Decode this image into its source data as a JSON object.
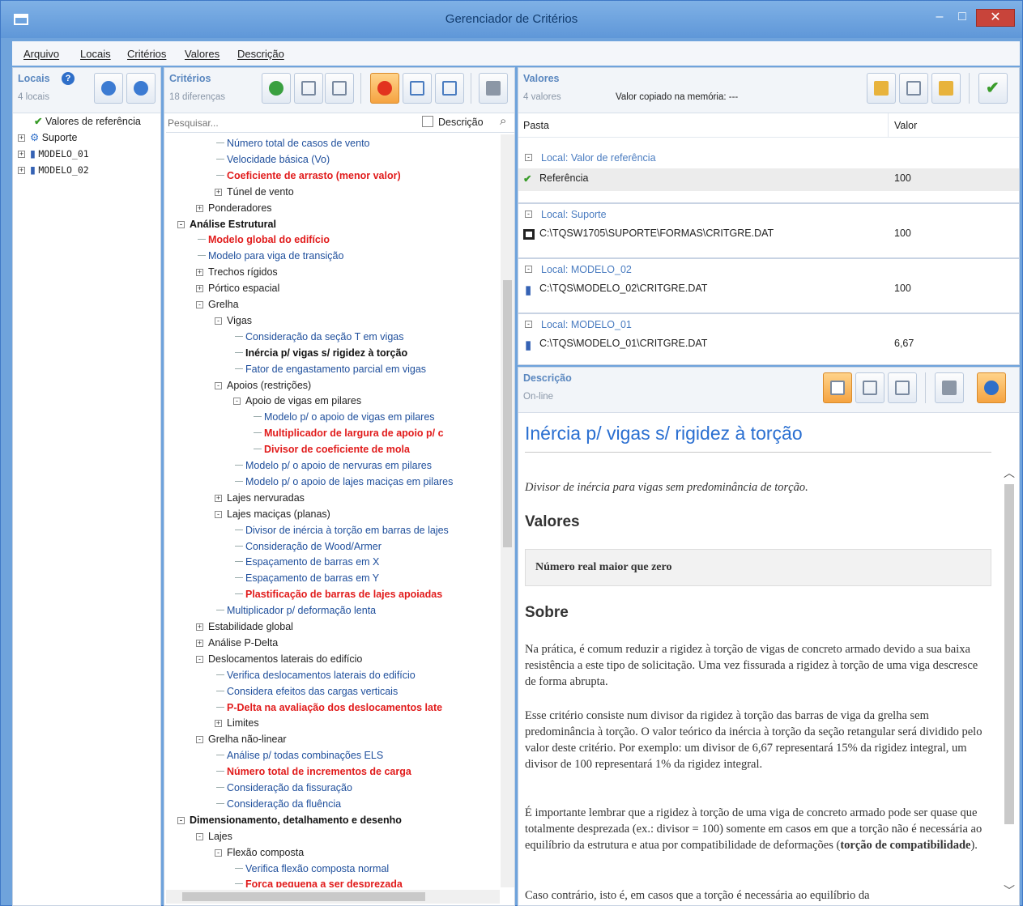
{
  "window": {
    "title": "Gerenciador de Critérios",
    "minimize": "–",
    "maximize": "□",
    "close": "✕"
  },
  "menu": [
    "Arquivo",
    "Locais",
    "Critérios",
    "Valores",
    "Descrição"
  ],
  "locais": {
    "title": "Locais",
    "subtitle": "4 locais",
    "items": [
      "Valores de referência",
      "Suporte",
      "MODELO_01",
      "MODELO_02"
    ]
  },
  "criterios": {
    "title": "Critérios",
    "subtitle": "18 diferenças",
    "search_placeholder": "Pesquisar...",
    "desc_check": "Descrição",
    "tree": [
      {
        "t": "Número total de casos de vento",
        "d": 3,
        "s": "b"
      },
      {
        "t": "Velocidade básica (Vo)",
        "d": 3,
        "s": "b"
      },
      {
        "t": "Coeficiente de arrasto (menor valor)",
        "d": 3,
        "s": "r"
      },
      {
        "t": "Túnel de vento",
        "d": 3,
        "s": "k",
        "e": 1
      },
      {
        "t": "Ponderadores",
        "d": 2,
        "s": "k",
        "e": 1
      },
      {
        "t": "Análise Estrutural",
        "d": 1,
        "s": "kb",
        "e": 2
      },
      {
        "t": "Modelo global do edifício",
        "d": 2,
        "s": "r"
      },
      {
        "t": "Modelo para viga de transição",
        "d": 2,
        "s": "b"
      },
      {
        "t": "Trechos rígidos",
        "d": 2,
        "s": "k",
        "e": 1
      },
      {
        "t": "Pórtico espacial",
        "d": 2,
        "s": "k",
        "e": 1
      },
      {
        "t": "Grelha",
        "d": 2,
        "s": "k",
        "e": 2
      },
      {
        "t": "Vigas",
        "d": 3,
        "s": "k",
        "e": 2
      },
      {
        "t": "Consideração da seção T em vigas",
        "d": 4,
        "s": "b"
      },
      {
        "t": "Inércia p/ vigas s/ rigidez à torção",
        "d": 4,
        "s": "kb"
      },
      {
        "t": "Fator de engastamento parcial em vigas",
        "d": 4,
        "s": "b"
      },
      {
        "t": "Apoios (restrições)",
        "d": 3,
        "s": "k",
        "e": 2
      },
      {
        "t": "Apoio de vigas em pilares",
        "d": 4,
        "s": "k",
        "e": 2
      },
      {
        "t": "Modelo p/ o apoio de vigas em pilares",
        "d": 5,
        "s": "b"
      },
      {
        "t": "Multiplicador de largura de apoio p/ c",
        "d": 5,
        "s": "r"
      },
      {
        "t": "Divisor de coeficiente de mola",
        "d": 5,
        "s": "r"
      },
      {
        "t": "Modelo p/ o apoio de nervuras em pilares",
        "d": 4,
        "s": "b"
      },
      {
        "t": "Modelo p/ o apoio de lajes maciças em pilares",
        "d": 4,
        "s": "b"
      },
      {
        "t": "Lajes nervuradas",
        "d": 3,
        "s": "k",
        "e": 1
      },
      {
        "t": "Lajes maciças (planas)",
        "d": 3,
        "s": "k",
        "e": 2
      },
      {
        "t": "Divisor de inércia à torção em barras de lajes",
        "d": 4,
        "s": "b"
      },
      {
        "t": "Consideração de Wood/Armer",
        "d": 4,
        "s": "b"
      },
      {
        "t": "Espaçamento de barras em X",
        "d": 4,
        "s": "b"
      },
      {
        "t": "Espaçamento de barras em Y",
        "d": 4,
        "s": "b"
      },
      {
        "t": "Plastificação de barras de lajes apoiadas",
        "d": 4,
        "s": "r"
      },
      {
        "t": "Multiplicador p/ deformação lenta",
        "d": 3,
        "s": "b"
      },
      {
        "t": "Estabilidade global",
        "d": 2,
        "s": "k",
        "e": 1
      },
      {
        "t": "Análise P-Delta",
        "d": 2,
        "s": "k",
        "e": 1
      },
      {
        "t": "Deslocamentos laterais do edifício",
        "d": 2,
        "s": "k",
        "e": 2
      },
      {
        "t": "Verifica deslocamentos laterais do edifício",
        "d": 3,
        "s": "b"
      },
      {
        "t": "Considera efeitos das cargas verticais",
        "d": 3,
        "s": "b"
      },
      {
        "t": "P-Delta na avaliação dos deslocamentos late",
        "d": 3,
        "s": "r"
      },
      {
        "t": "Limites",
        "d": 3,
        "s": "k",
        "e": 1
      },
      {
        "t": "Grelha não-linear",
        "d": 2,
        "s": "k",
        "e": 2
      },
      {
        "t": "Análise p/ todas combinações ELS",
        "d": 3,
        "s": "b"
      },
      {
        "t": "Número total de incrementos de carga",
        "d": 3,
        "s": "r"
      },
      {
        "t": "Consideração da fissuração",
        "d": 3,
        "s": "b"
      },
      {
        "t": "Consideração da fluência",
        "d": 3,
        "s": "b"
      },
      {
        "t": "Dimensionamento, detalhamento e desenho",
        "d": 1,
        "s": "kb",
        "e": 2
      },
      {
        "t": "Lajes",
        "d": 2,
        "s": "k",
        "e": 2
      },
      {
        "t": "Flexão composta",
        "d": 3,
        "s": "k",
        "e": 2
      },
      {
        "t": "Verifica flexão composta normal",
        "d": 4,
        "s": "b"
      },
      {
        "t": "Força pequena a ser desprezada",
        "d": 4,
        "s": "r"
      }
    ]
  },
  "valores": {
    "title": "Valores",
    "subtitle": "4 valores",
    "memory": "Valor copiado na memória: ---",
    "col_pasta": "Pasta",
    "col_valor": "Valor",
    "groups": [
      {
        "local": "Local: Valor de referência",
        "path": "Referência",
        "value": "100"
      },
      {
        "local": "Local: Suporte",
        "path": "C:\\TQSW1705\\SUPORTE\\FORMAS\\CRITGRE.DAT",
        "value": "100"
      },
      {
        "local": "Local: MODELO_02",
        "path": "C:\\TQS\\MODELO_02\\CRITGRE.DAT",
        "value": "100"
      },
      {
        "local": "Local: MODELO_01",
        "path": "C:\\TQS\\MODELO_01\\CRITGRE.DAT",
        "value": "6,67"
      }
    ]
  },
  "descricao": {
    "title": "Descrição",
    "subtitle": "On-line",
    "heading": "Inércia p/ vigas s/ rigidez à torção",
    "intro": "Divisor de inércia para vigas sem predominância de torção.",
    "valores_h": "Valores",
    "valores_box": "Número real maior que zero",
    "sobre_h": "Sobre",
    "p1": "Na prática, é comum reduzir a rigidez à torção de vigas de concreto armado devido a sua baixa resistência a este tipo de solicitação. Uma vez fissurada a rigidez à torção de uma viga descresce de forma abrupta.",
    "p2": "Esse critério consiste num divisor da rigidez à torção das barras de viga da grelha sem predominância à torção. O valor teórico da inércia à torção da seção retangular será dividido pelo valor deste critério. Por exemplo: um divisor de 6,67 representará 15% da rigidez integral, um divisor de 100 representará 1% da rigidez integral.",
    "p3a": "É importante lembrar que a rigidez à torção de uma viga de concreto armado pode ser quase que totalmente desprezada (ex.: divisor = 100) somente em casos em que a torção não é necessária ao equilíbrio da estrutura e atua por compatibilidade de deformações (",
    "p3b": "torção de compatibilidade",
    "p3c": ").",
    "p4": "Caso contrário, isto é, em casos que a torção é necessária ao equilíbrio da"
  },
  "colors": {
    "accent": "#2a6fd1",
    "red": "#e11b1b",
    "window": "#6fa3dc"
  }
}
